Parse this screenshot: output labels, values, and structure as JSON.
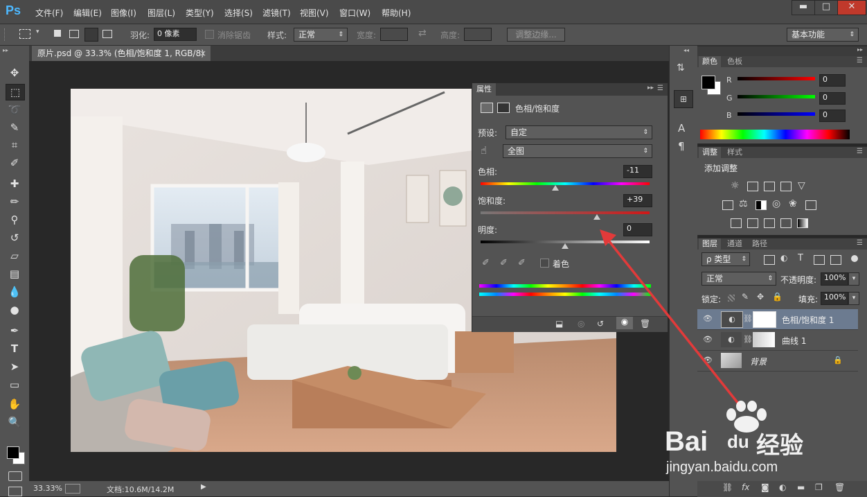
{
  "app": {
    "logo": "Ps"
  },
  "menu": [
    "文件(F)",
    "编辑(E)",
    "图像(I)",
    "图层(L)",
    "类型(Y)",
    "选择(S)",
    "滤镜(T)",
    "视图(V)",
    "窗口(W)",
    "帮助(H)"
  ],
  "window_buttons": {
    "minimize": "▬",
    "maximize": "□",
    "close": "✕"
  },
  "options": {
    "feather_label": "羽化:",
    "feather_value": "0 像素",
    "antialias_label": "消除锯齿",
    "style_label": "样式:",
    "style_value": "正常",
    "width_label": "宽度:",
    "height_label": "高度:",
    "refine_edge": "调整边缘...",
    "workspace": "基本功能"
  },
  "document": {
    "tab_title": "原片.psd @ 33.3% (色相/饱和度 1, RGB/8)",
    "close": "×",
    "zoom": "33.33%",
    "doc_size": "文档:10.6M/14.2M"
  },
  "properties": {
    "panel_title": "属性",
    "adj_title": "色相/饱和度",
    "preset_label": "预设:",
    "preset_value": "自定",
    "channel_value": "全图",
    "hue_label": "色相:",
    "hue_value": "-11",
    "sat_label": "饱和度:",
    "sat_value": "+39",
    "light_label": "明度:",
    "light_value": "0",
    "colorize_label": "着色"
  },
  "color_panel": {
    "tabs": [
      "颜色",
      "色板"
    ],
    "r_label": "R",
    "g_label": "G",
    "b_label": "B",
    "r": "0",
    "g": "0",
    "b": "0"
  },
  "adjust_panel": {
    "tabs": [
      "调整",
      "样式"
    ],
    "add_label": "添加调整"
  },
  "layers_panel": {
    "tabs": [
      "图层",
      "通道",
      "路径"
    ],
    "filter_value": "ρ 类型",
    "blend_value": "正常",
    "opacity_label": "不透明度:",
    "opacity_value": "100%",
    "lock_label": "锁定:",
    "fill_label": "填充:",
    "fill_value": "100%",
    "layers": [
      {
        "name": "色相/饱和度 1"
      },
      {
        "name": "曲线 1"
      },
      {
        "name": "背景"
      }
    ]
  },
  "watermark": {
    "brand": "Bai",
    "brand2": "du",
    "brand_cn": "经验",
    "url": "jingyan.baidu.com"
  },
  "colors": {
    "accent": "#4db8ff",
    "annotation_arrow": "#e23a3a"
  }
}
